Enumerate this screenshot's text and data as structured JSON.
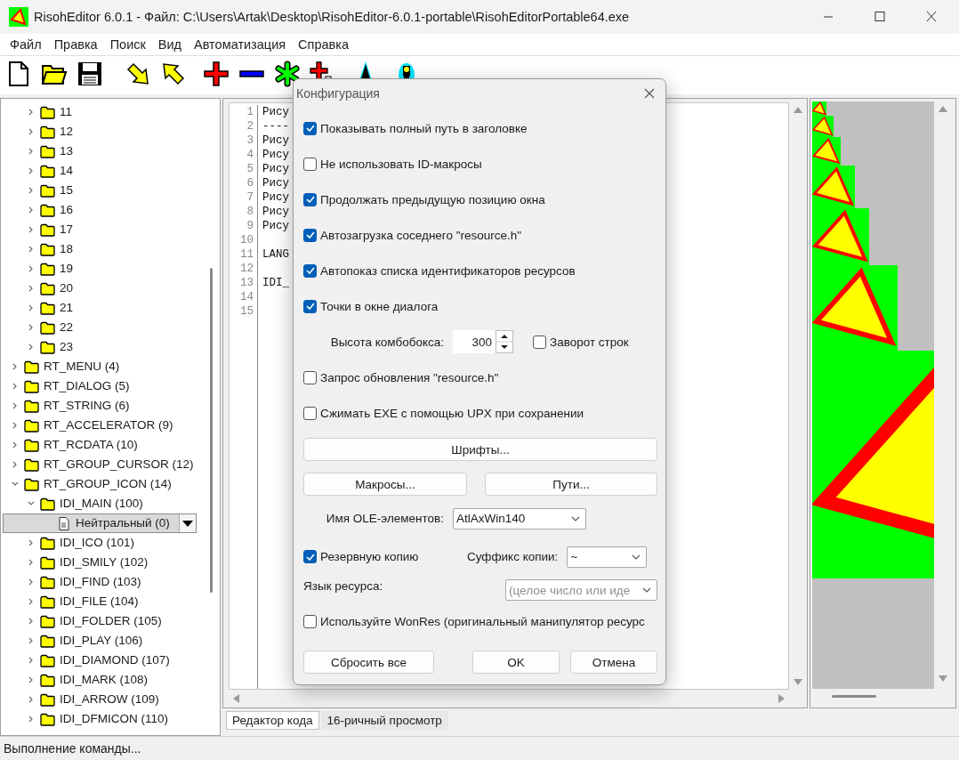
{
  "window": {
    "title": "RisohEditor 6.0.1 - Файл: C:\\Users\\Artak\\Desktop\\RisohEditor-6.0.1-portable\\RisohEditorPortable64.exe"
  },
  "menu": [
    "Файл",
    "Правка",
    "Поиск",
    "Вид",
    "Автоматизация",
    "Справка"
  ],
  "tree": {
    "scrolled_children": [
      {
        "label": "11",
        "expanded": false,
        "selected": false
      },
      {
        "label": "12",
        "expanded": false,
        "selected": false
      },
      {
        "label": "13",
        "expanded": false,
        "selected": false
      },
      {
        "label": "14",
        "expanded": false,
        "selected": false
      },
      {
        "label": "15",
        "expanded": false,
        "selected": false
      },
      {
        "label": "16",
        "expanded": false,
        "selected": false
      },
      {
        "label": "17",
        "expanded": false,
        "selected": false
      },
      {
        "label": "18",
        "expanded": false,
        "selected": false
      },
      {
        "label": "19",
        "expanded": false,
        "selected": false
      },
      {
        "label": "20",
        "expanded": false,
        "selected": false
      },
      {
        "label": "21",
        "expanded": false,
        "selected": false
      },
      {
        "label": "22",
        "expanded": false,
        "selected": false
      },
      {
        "label": "23",
        "expanded": false,
        "selected": false
      }
    ],
    "items": [
      {
        "label": "RT_MENU (4)",
        "expanded": false,
        "selected": false
      },
      {
        "label": "RT_DIALOG (5)",
        "expanded": false,
        "selected": false
      },
      {
        "label": "RT_STRING (6)",
        "expanded": false,
        "selected": false
      },
      {
        "label": "RT_ACCELERATOR (9)",
        "expanded": false,
        "selected": false
      },
      {
        "label": "RT_RCDATA (10)",
        "expanded": false,
        "selected": false
      },
      {
        "label": "RT_GROUP_CURSOR (12)",
        "expanded": false,
        "selected": false
      },
      {
        "label": "RT_GROUP_ICON (14)",
        "expanded": true,
        "selected": false,
        "children": [
          {
            "label": "IDI_MAIN (100)",
            "expanded": true,
            "selected": false,
            "children": [
              {
                "label": "Нейтральный (0)",
                "selected": true
              }
            ]
          },
          {
            "label": "IDI_ICO (101)",
            "expanded": false,
            "selected": false
          },
          {
            "label": "IDI_SMILY (102)",
            "expanded": false,
            "selected": false
          },
          {
            "label": "IDI_FIND (103)",
            "expanded": false,
            "selected": false
          },
          {
            "label": "IDI_FILE (104)",
            "expanded": false,
            "selected": false
          },
          {
            "label": "IDI_FOLDER (105)",
            "expanded": false,
            "selected": false
          },
          {
            "label": "IDI_PLAY (106)",
            "expanded": false,
            "selected": false
          },
          {
            "label": "IDI_DIAMOND (107)",
            "expanded": false,
            "selected": false
          },
          {
            "label": "IDI_MARK (108)",
            "expanded": false,
            "selected": false
          },
          {
            "label": "IDI_ARROW (109)",
            "expanded": false,
            "selected": false
          },
          {
            "label": "IDI_DFMICON (110)",
            "expanded": false,
            "selected": false
          }
        ]
      }
    ]
  },
  "editor": {
    "lines": [
      {
        "number": "1",
        "text": "Рису"
      },
      {
        "number": "2",
        "text": "----"
      },
      {
        "number": "3",
        "text": "Рису"
      },
      {
        "number": "4",
        "text": "Рису"
      },
      {
        "number": "5",
        "text": "Рису"
      },
      {
        "number": "6",
        "text": "Рису"
      },
      {
        "number": "7",
        "text": "Рису"
      },
      {
        "number": "8",
        "text": "Рису"
      },
      {
        "number": "9",
        "text": "Рису"
      },
      {
        "number": "10"
      },
      {
        "number": "11",
        "text": "LANG"
      },
      {
        "number": "12"
      },
      {
        "number": "13",
        "text": "IDI_"
      },
      {
        "number": "14"
      },
      {
        "number": "15"
      }
    ]
  },
  "tabs": [
    {
      "label": "Редактор кода",
      "selected": true
    },
    {
      "label": "16-ричный просмотр",
      "selected": false
    }
  ],
  "status_bar": "Выполнение команды...",
  "dialog": {
    "title": "Конфигурация",
    "rows": [
      {
        "kind": "checkbox",
        "label": "Показывать полный путь в заголовке",
        "checked": true
      },
      {
        "kind": "checkbox",
        "label": "Не использовать ID-макросы",
        "checked": false
      },
      {
        "kind": "checkbox",
        "label": "Продолжать предыдущую позицию окна",
        "checked": true
      },
      {
        "kind": "checkbox",
        "label": "Автозагрузка соседнего \"resource.h\"",
        "checked": true
      },
      {
        "kind": "checkbox",
        "label": "Автопоказ списка идентификаторов ресурсов",
        "checked": true
      },
      {
        "kind": "checkbox",
        "label": "Точки в окне диалога",
        "checked": true
      },
      {
        "kind": "spin",
        "label": "Высота комбобокса:",
        "value": "300",
        "checkbox": {
          "label": "Заворот строк",
          "checked": false
        }
      },
      {
        "kind": "checkbox",
        "label": "Запрос обновления \"resource.h\"",
        "checked": false
      },
      {
        "kind": "checkbox",
        "label": "Сжимать EXE с помощью UPX при сохранении",
        "checked": false
      },
      {
        "kind": "wide_button",
        "label": "Шрифты..."
      },
      {
        "kind": "button_pair",
        "buttons": [
          "Макросы...",
          "Пути..."
        ]
      },
      {
        "kind": "select",
        "label": "Имя OLE-элементов:",
        "value": "AtlAxWin140"
      },
      {
        "kind": "backup",
        "label": "Резервную копию",
        "checked": true,
        "suffix_label": "Суффикс копии:",
        "suffix_value": "~"
      },
      {
        "kind": "language",
        "label": "Язык ресурса:",
        "placeholder": "(целое число или иде"
      },
      {
        "kind": "checkbox",
        "label": "Используйте WonRes (оригинальный манипулятор ресурс",
        "checked": false
      }
    ],
    "buttons": [
      "Сбросить все",
      "OK",
      "Отмена"
    ]
  }
}
